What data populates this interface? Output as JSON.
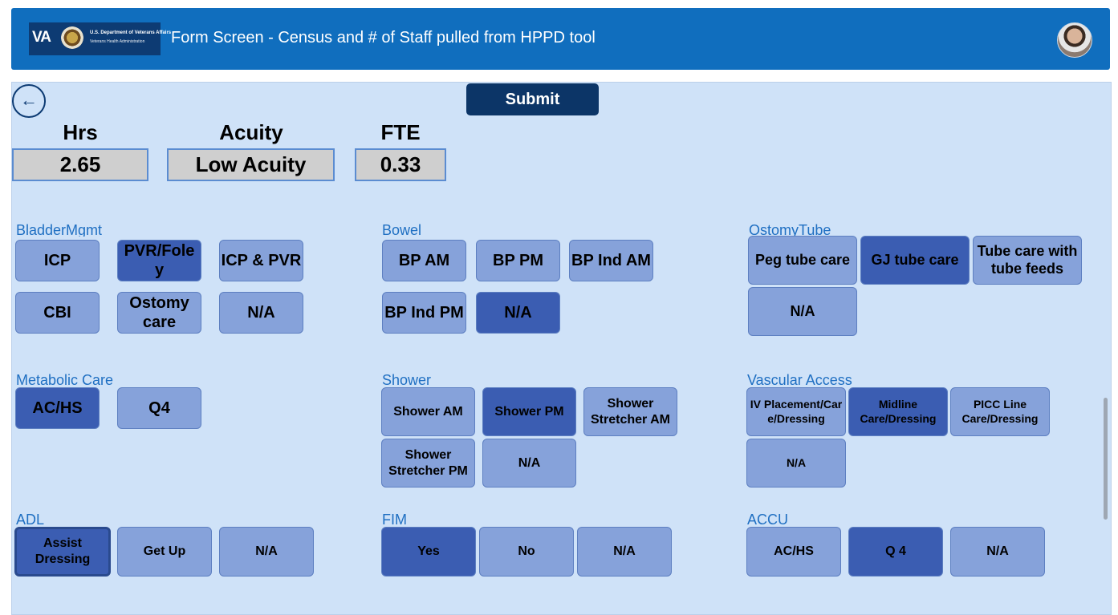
{
  "header": {
    "logo_text": "VA",
    "logo_line1": "U.S. Department of Veterans Affairs",
    "logo_line2": "Veterans Health Administration",
    "title": "Form Screen - Census and # of Staff pulled from HPPD tool"
  },
  "toolbar": {
    "back_icon": "←",
    "submit_label": "Submit"
  },
  "metrics": [
    {
      "label": "Hrs",
      "value": "2.65"
    },
    {
      "label": "Acuity",
      "value": "Low Acuity"
    },
    {
      "label": "FTE",
      "value": "0.33"
    }
  ],
  "groups": {
    "bladder": {
      "label": "BladderMgmt",
      "buttons": [
        "ICP",
        "PVR/Fole y",
        "ICP & PVR",
        "CBI",
        "Ostomy care",
        "N/A"
      ],
      "selected": [
        "PVR/Fole y"
      ]
    },
    "bowel": {
      "label": "Bowel",
      "buttons": [
        "BP AM",
        "BP PM",
        "BP Ind AM",
        "BP Ind PM",
        "N/A"
      ],
      "selected": [
        "N/A"
      ]
    },
    "ostomy": {
      "label": "OstomyTube",
      "buttons": [
        "Peg tube care",
        "GJ tube care",
        "Tube care with tube feeds",
        "N/A"
      ],
      "selected": [
        "GJ tube care"
      ]
    },
    "metabolic": {
      "label": "Metabolic Care",
      "buttons": [
        "AC/HS",
        "Q4"
      ],
      "selected": [
        "AC/HS"
      ]
    },
    "shower": {
      "label": "Shower",
      "buttons": [
        "Shower AM",
        "Shower PM",
        "Shower Stretcher AM",
        "Shower Stretcher PM",
        "N/A"
      ],
      "selected": [
        "Shower PM"
      ]
    },
    "vascular": {
      "label": "Vascular Access",
      "buttons": [
        "IV Placement/Car e/Dressing",
        "Midline Care/Dressing",
        "PICC Line Care/Dressing",
        "N/A"
      ],
      "selected": [
        "Midline Care/Dressing"
      ]
    },
    "adl": {
      "label": "ADL",
      "buttons": [
        "Assist Dressing",
        "Get Up",
        "N/A"
      ],
      "selected": [
        "Assist Dressing"
      ]
    },
    "fim": {
      "label": "FIM",
      "buttons": [
        "Yes",
        "No",
        "N/A"
      ],
      "selected": [
        "Yes"
      ]
    },
    "accu": {
      "label": "ACCU",
      "buttons": [
        "AC/HS",
        "Q 4",
        "N/A"
      ],
      "selected": [
        "Q 4"
      ]
    }
  },
  "colors": {
    "header": "#106ebe",
    "panel": "#cfe2f8",
    "button": "#86a2da",
    "button_selected": "#3b5db2",
    "submit": "#0c3567"
  }
}
